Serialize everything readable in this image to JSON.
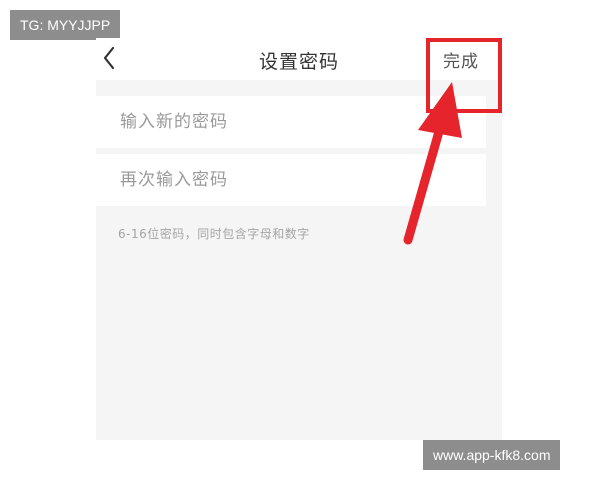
{
  "watermark": {
    "top_left": "TG: MYYJJPP",
    "bottom_right": "www.app-kfk8.com"
  },
  "header": {
    "back_icon": "chevron-left-icon",
    "title": "设置密码",
    "done_label": "完成"
  },
  "form": {
    "new_password_placeholder": "输入新的密码",
    "confirm_password_placeholder": "再次输入密码",
    "hint": "6-16位密码，同时包含字母和数字"
  },
  "colors": {
    "annotation_red": "#e5242b",
    "background": "#f5f5f6"
  }
}
